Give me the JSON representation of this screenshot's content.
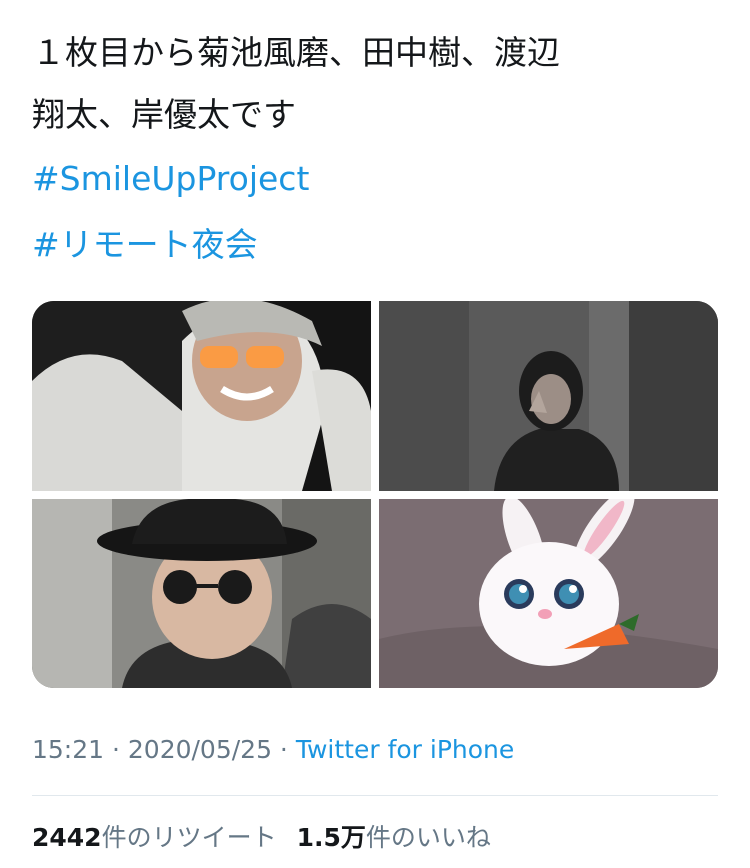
{
  "tweet": {
    "text_line1": "１枚目から菊池風磨、田中樹、渡辺",
    "text_line2": "翔太、岸優太です",
    "hashtag1": "#SmileUpProject",
    "hashtag2": "#リモート夜会"
  },
  "media": {
    "images": [
      {
        "alt": "photo-1"
      },
      {
        "alt": "photo-2"
      },
      {
        "alt": "photo-3"
      },
      {
        "alt": "photo-4"
      }
    ]
  },
  "meta": {
    "time": "15:21",
    "separator": " · ",
    "date": "2020/05/25",
    "separator2": " · ",
    "source": "Twitter for iPhone"
  },
  "stats": {
    "retweet_count": "2442",
    "retweet_label": "件のリツイート",
    "like_count": "1.5万",
    "like_label": "件のいいね"
  },
  "colors": {
    "link": "#1b95e0",
    "muted": "#657786",
    "text": "#14171a"
  }
}
